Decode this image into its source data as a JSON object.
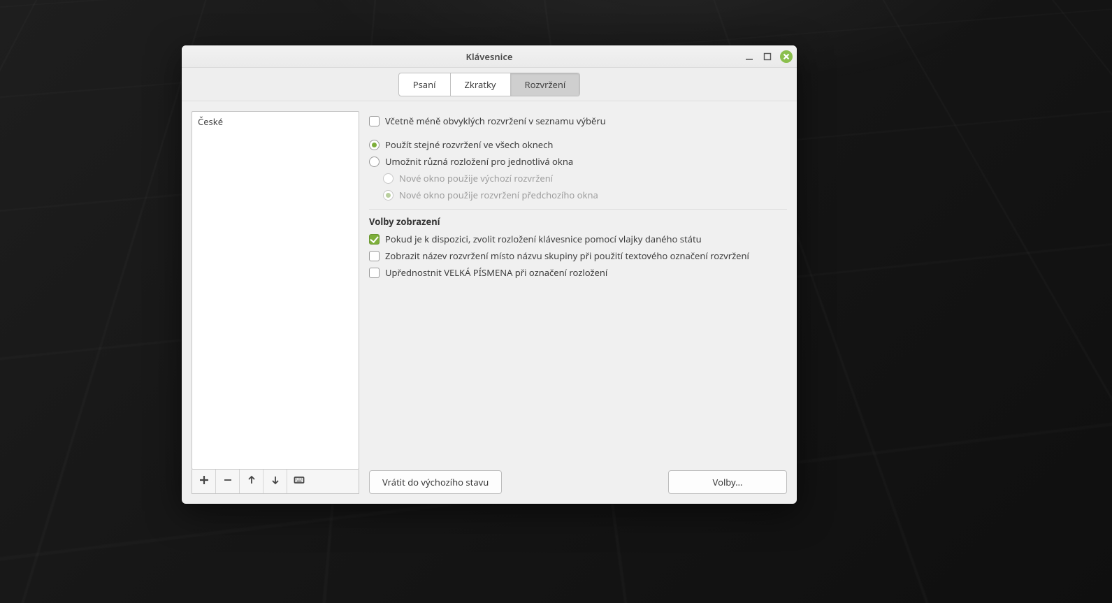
{
  "window": {
    "title": "Klávesnice"
  },
  "tabs": {
    "typing": "Psaní",
    "shortcuts": "Zkratky",
    "layouts": "Rozvržení"
  },
  "layouts_list": {
    "items": [
      "České"
    ]
  },
  "options": {
    "include_exotic": "Včetně méně obvyklých rozvržení v seznamu výběru",
    "same_all_windows": "Použít stejné rozvržení ve všech oknech",
    "per_window": "Umožnit různá rozložení pro jednotlivá okna",
    "new_window_default": "Nové okno použije výchozí rozvržení",
    "new_window_prev": "Nové okno použije rozvržení předchozího okna"
  },
  "display": {
    "section_title": "Volby zobrazení",
    "use_flag": "Pokud je k dispozici, zvolit rozložení klávesnice pomocí vlajky daného státu",
    "show_layout_name": "Zobrazit název rozvržení místo názvu skupiny při použití textového označení rozvržení",
    "prefer_uppercase": "Upřednostnit VELKÁ PÍSMENA při označení rozložení"
  },
  "buttons": {
    "reset": "Vrátit do výchozího stavu",
    "options": "Volby…"
  }
}
